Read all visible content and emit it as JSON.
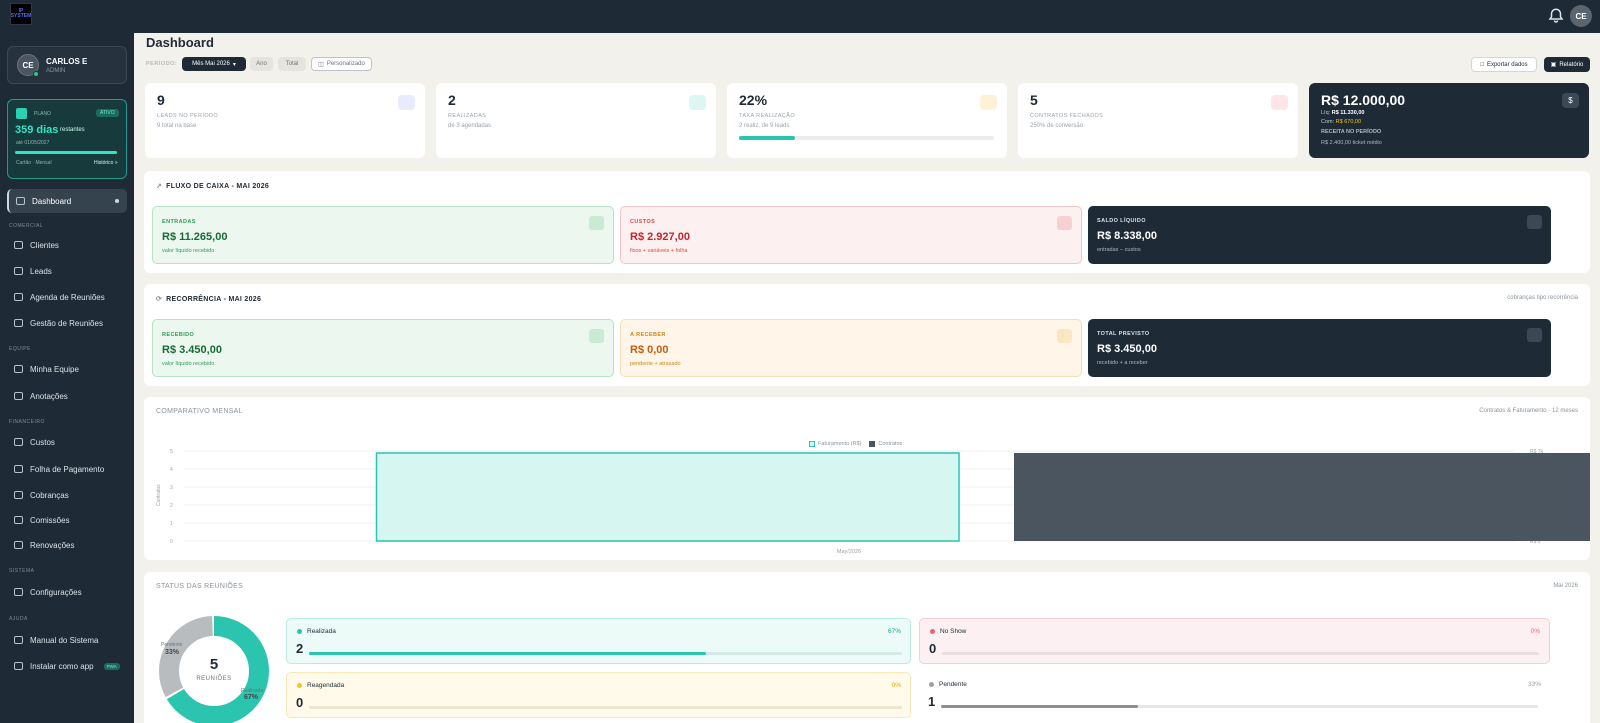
{
  "app": {
    "logo_text": "IP\nSYSTEM"
  },
  "topbar": {
    "avatar_initials": "CE"
  },
  "user": {
    "initials": "CE",
    "name": "CARLOS E",
    "role": "ADMIN"
  },
  "plan": {
    "label": "PLANO",
    "badge": "ATIVO",
    "days": "359 dias",
    "days_suffix": "restantes",
    "until": "até 01/05/2027",
    "payment": "Cartão · Mensal",
    "history_link": "Histórico »",
    "progress": 0.98
  },
  "nav": {
    "dashboard": "Dashboard",
    "sec_comercial": "COMERCIAL",
    "clientes": "Clientes",
    "leads": "Leads",
    "agenda": "Agenda de Reuniões",
    "gestao": "Gestão de Reuniões",
    "sec_equipe": "EQUIPE",
    "equipe": "Minha Equipe",
    "anotacoes": "Anotações",
    "sec_financeiro": "FINANCEIRO",
    "custos": "Custos",
    "folha": "Folha de Pagamento",
    "cobrancas": "Cobranças",
    "comissoes": "Comissões",
    "renovacoes": "Renovações",
    "sec_sistema": "SISTEMA",
    "config": "Configurações",
    "sec_ajuda": "AJUDA",
    "manual": "Manual do Sistema",
    "instalar": "Instalar como app",
    "pwa_badge": "PWA"
  },
  "header": {
    "title": "Dashboard",
    "period_label": "PERÍODO:",
    "chip_mes": "Mês Mai 2026",
    "chip_ano": "Ano",
    "chip_total": "Total",
    "chip_custom": "Personalizado",
    "export": "Exportar dados",
    "report": "Relatório"
  },
  "kpis": {
    "leads": {
      "value": "9",
      "label": "LEADS NO PERÍODO",
      "sub": "9 total na base"
    },
    "realizadas": {
      "value": "2",
      "label": "REALIZADAS",
      "sub": "de 3 agendadas"
    },
    "taxa": {
      "value": "22%",
      "label": "TAXA REALIZAÇÃO",
      "sub": "2 realiz. de 9 leads",
      "progress": 22
    },
    "contratos": {
      "value": "5",
      "label": "CONTRATOS FECHADOS",
      "sub": "250% de conversão"
    },
    "receita": {
      "value": "R$ 12.000,00",
      "liq_label": "Líq:",
      "liq_value": "R$ 11.330,00",
      "com_label": "Com:",
      "com_value": "R$ 670,00",
      "label": "RECEITA NO PERÍODO",
      "sub": "R$ 2.400,00 ticket médio",
      "icon_symbol": "$"
    }
  },
  "cashflow": {
    "title": "FLUXO DE CAIXA - MAI 2026",
    "entradas": {
      "label": "ENTRADAS",
      "value": "R$ 11.265,00",
      "sub": "valor líquido recebido"
    },
    "custos": {
      "label": "CUSTOS",
      "value": "R$ 2.927,00",
      "sub": "fixos + variáveis + folha"
    },
    "saldo": {
      "label": "SALDO LÍQUIDO",
      "value": "R$ 8.338,00",
      "sub": "entradas − custos"
    }
  },
  "recurrence": {
    "title": "RECORRÊNCIA - MAI 2026",
    "right_note": "cobranças tipo recorrência",
    "recebido": {
      "label": "RECEBIDO",
      "value": "R$ 3.450,00",
      "sub": "valor líquido recebido"
    },
    "receber": {
      "label": "A RECEBER",
      "value": "R$ 0,00",
      "sub": "pendente + atrasado"
    },
    "previsto": {
      "label": "TOTAL PREVISTO",
      "value": "R$ 3.450,00",
      "sub": "recebido + a receber"
    }
  },
  "comparativo": {
    "title": "COMPARATIVO MENSAL",
    "right_note": "Contratos & Faturamento - 12 meses"
  },
  "chart_data": {
    "type": "bar",
    "categories": [
      "May/2026"
    ],
    "series": [
      {
        "name": "Faturamento (R$)",
        "values": [
          12000
        ],
        "axis": "right",
        "color": "#2bc4ae"
      },
      {
        "name": "Contratos",
        "values": [
          5
        ],
        "axis": "left",
        "color": "#4b5560"
      }
    ],
    "ylabel_left": "Contratos",
    "ylabel_right": "Faturamento",
    "ylim_left": [
      0,
      5
    ],
    "ylim_right": [
      0,
      7000
    ],
    "yticks_left": [
      "0",
      "1",
      "2",
      "3",
      "4",
      "5"
    ],
    "yticks_right": [
      "R$ 0",
      "R$ 1k",
      "R$ 2k",
      "R$ 3k",
      "R$ 4k",
      "R$ 5k",
      "R$ 6k",
      "R$ 7k"
    ],
    "legend": "top-center",
    "grid": true
  },
  "status": {
    "title": "STATUS DAS REUNIÕES",
    "right_note": "Mai 2026",
    "donut": {
      "total": "5",
      "label": "REUNIÕES",
      "pendente_label": "Pendente",
      "pendente_pct": "33%",
      "realizada_label": "Realizada",
      "realizada_pct": "67%"
    },
    "realizada": {
      "name": "Realizada",
      "count": "2",
      "pct": "67%",
      "fraction": 0.67,
      "color": "#2bc4ae"
    },
    "noshow": {
      "name": "No Show",
      "count": "0",
      "pct": "0%",
      "fraction": 0,
      "color": "#f0607a"
    },
    "reagendada": {
      "name": "Reagendada",
      "count": "0",
      "pct": "0%",
      "fraction": 0,
      "color": "#f5c51f"
    },
    "pendente": {
      "name": "Pendente",
      "count": "1",
      "pct": "33%",
      "fraction": 0.33,
      "color": "#9aa0a6"
    }
  }
}
